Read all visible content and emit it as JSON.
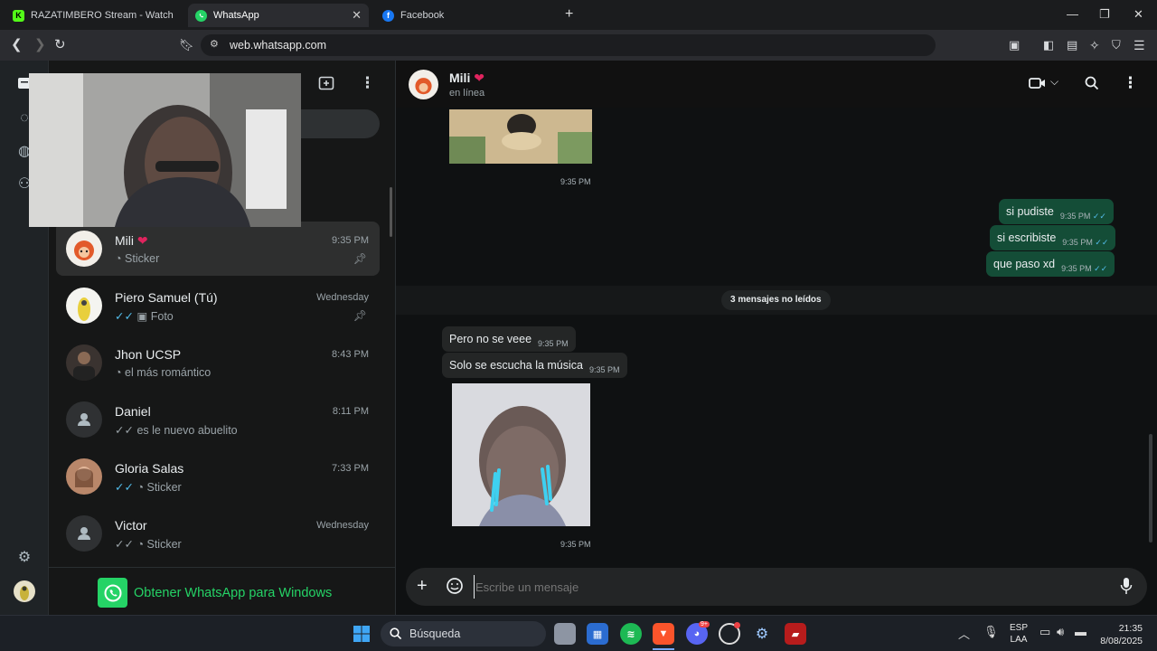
{
  "browser": {
    "tabs": [
      {
        "title": "RAZATIMBERO Stream - Watch Live c",
        "favicon": "K"
      },
      {
        "title": "WhatsApp",
        "favicon": "whatsapp"
      },
      {
        "title": "Facebook",
        "favicon": "f"
      }
    ],
    "url": "web.whatsapp.com"
  },
  "chat_list": [
    {
      "name": "Mili",
      "time": "9:35 PM",
      "preview": "Sticker",
      "pinned": true,
      "selected": true
    },
    {
      "name": "Piero Samuel (Tú)",
      "time": "Wednesday",
      "preview": "Foto",
      "pinned": true
    },
    {
      "name": "Jhon UCSP",
      "time": "8:43 PM",
      "preview": "el más romántico"
    },
    {
      "name": "Daniel",
      "time": "8:11 PM",
      "preview": "es le nuevo abuelito"
    },
    {
      "name": "Gloria Salas",
      "time": "7:33 PM",
      "preview": "Sticker"
    },
    {
      "name": "Victor",
      "time": "Wednesday",
      "preview": "Sticker"
    }
  ],
  "get_app": "Obtener WhatsApp para Windows",
  "conversation": {
    "contact": "Mili",
    "status": "en línea",
    "image_time_1": "9:35 PM",
    "outgoing": [
      {
        "text": "si pudiste",
        "time": "9:35 PM"
      },
      {
        "text": "si escribiste",
        "time": "9:35 PM"
      },
      {
        "text": "que paso xd",
        "time": "9:35 PM"
      }
    ],
    "unread_banner": "3 mensajes no leídos",
    "incoming": [
      {
        "text": "Pero no se veee",
        "time": "9:35 PM"
      },
      {
        "text": "Solo se escucha la música",
        "time": "9:35 PM"
      }
    ],
    "image_time_2": "9:35 PM",
    "composer_placeholder": "Escribe un mensaje"
  },
  "taskbar": {
    "search": "Búsqueda",
    "lang_1": "ESP",
    "lang_2": "LAA",
    "time": "21:35",
    "date": "8/08/2025",
    "discord_badge": "9+"
  },
  "colors": {
    "accent": "#25d366",
    "outgoing_bubble": "#144d37",
    "read_tick": "#53bdeb"
  }
}
